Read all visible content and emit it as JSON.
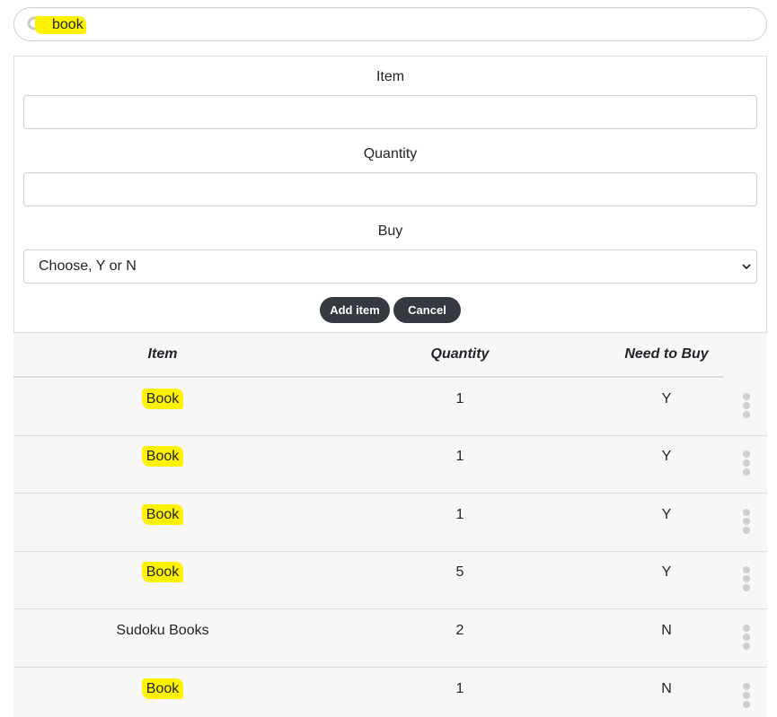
{
  "search": {
    "value": "book",
    "icon": "search-icon"
  },
  "form": {
    "item_label": "Item",
    "item_value": "",
    "quantity_label": "Quantity",
    "quantity_value": "",
    "buy_label": "Buy",
    "buy_selected": "Choose, Y or N",
    "add_button": "Add item",
    "cancel_button": "Cancel"
  },
  "table": {
    "headers": {
      "item": "Item",
      "quantity": "Quantity",
      "need": "Need to Buy"
    },
    "rows": [
      {
        "item": "Book",
        "quantity": "1",
        "need": "Y",
        "highlighted": true
      },
      {
        "item": "Book",
        "quantity": "1",
        "need": "Y",
        "highlighted": true
      },
      {
        "item": "Book",
        "quantity": "1",
        "need": "Y",
        "highlighted": true
      },
      {
        "item": "Book",
        "quantity": "5",
        "need": "Y",
        "highlighted": true
      },
      {
        "item": "Sudoku Books",
        "quantity": "2",
        "need": "N",
        "highlighted": false
      },
      {
        "item": "Book",
        "quantity": "1",
        "need": "N",
        "highlighted": true
      }
    ]
  },
  "colors": {
    "highlight": "#fff200",
    "button": "#343a40",
    "table_bg": "#f7f7f7"
  }
}
